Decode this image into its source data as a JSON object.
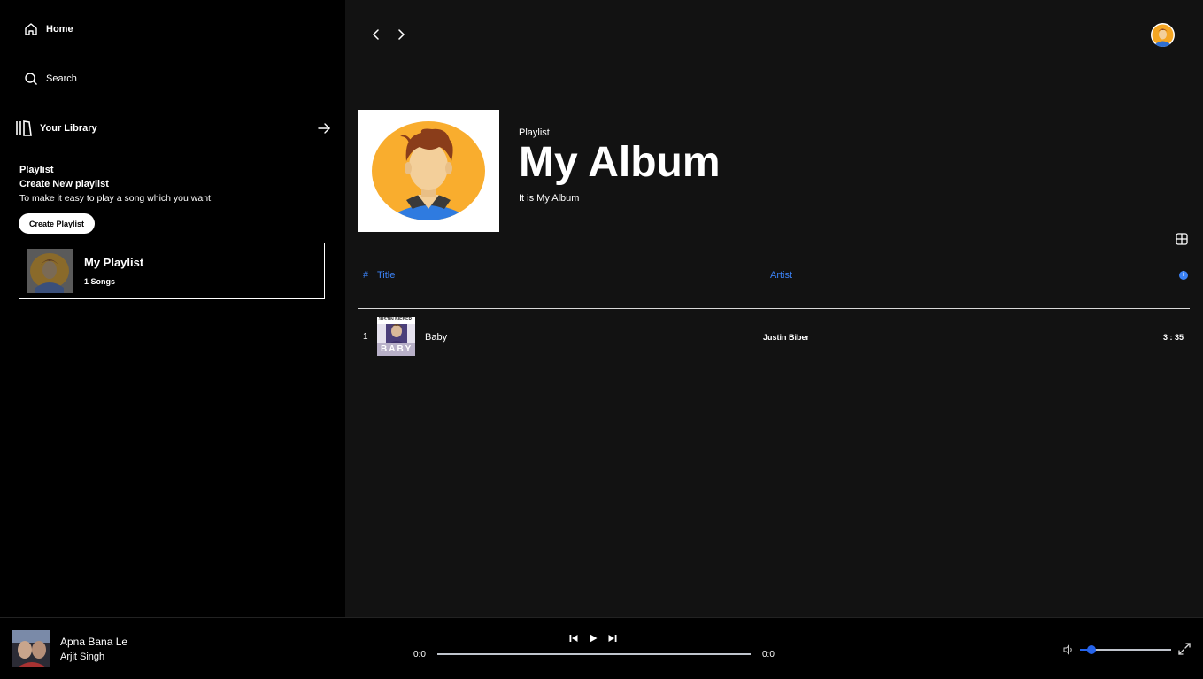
{
  "sidebar": {
    "home_label": "Home",
    "search_label": "Search",
    "library_label": "Your Library",
    "playlist_heading": "Playlist",
    "playlist_subheading": "Create New playlist",
    "playlist_description": "To make it easy to play a song which you want!",
    "create_button_label": "Create Playlist",
    "card": {
      "title": "My Playlist",
      "count": "1 Songs"
    }
  },
  "album": {
    "type_label": "Playlist",
    "title": "My Album",
    "description": "It is My Album"
  },
  "table": {
    "headers": {
      "num": "#",
      "title": "Title",
      "artist": "Artist",
      "info": "i"
    },
    "rows": [
      {
        "num": "1",
        "title": "Baby",
        "artist": "Justin Biber",
        "duration": "3 : 35",
        "thumb_text_top": "JUSTIN BIEBER",
        "thumb_text_bottom": "BABY"
      }
    ]
  },
  "player": {
    "title": "Apna Bana Le",
    "artist": "Arjit Singh",
    "time_current": "0:0",
    "time_total": "0:0",
    "progress": 0,
    "volume": 0.13
  },
  "colors": {
    "accent": "#3b82f6",
    "volume": "#2563eb",
    "sidebar_bg": "#000000",
    "main_bg": "#121212"
  },
  "icons": [
    "home-icon",
    "search-icon",
    "library-icon",
    "arrow-right-icon",
    "chevron-left-icon",
    "chevron-right-icon",
    "grid-icon",
    "info-icon",
    "previous-icon",
    "play-icon",
    "next-icon",
    "volume-icon",
    "fullscreen-icon"
  ]
}
